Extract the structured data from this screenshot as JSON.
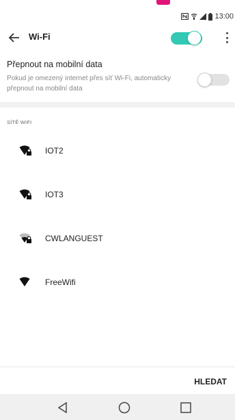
{
  "status": {
    "time": "13:00"
  },
  "header": {
    "title": "Wi-Fi",
    "wifi_enabled": true
  },
  "mobile_data": {
    "title": "Přepnout na mobilní data",
    "description": "Pokud je omezený internet přes síť Wi-Fi, automaticky přepnout na mobilní data",
    "enabled": false
  },
  "networks": {
    "header": "SÍTĚ WIFI",
    "items": [
      {
        "name": "IOT2",
        "secured": true
      },
      {
        "name": "IOT3",
        "secured": true
      },
      {
        "name": "CWLANGUEST",
        "secured": true
      },
      {
        "name": "FreeWifi",
        "secured": false
      }
    ]
  },
  "footer": {
    "search_label": "HLEDAT"
  },
  "colors": {
    "accent": "#33c9b4",
    "brand": "#e2147a"
  }
}
